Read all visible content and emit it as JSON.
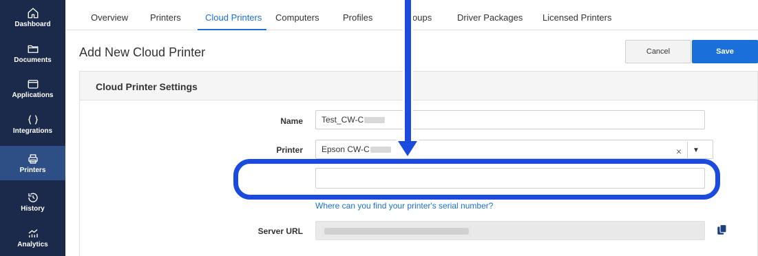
{
  "sidebar": {
    "items": [
      {
        "label": "Dashboard",
        "icon": "home-icon"
      },
      {
        "label": "Documents",
        "icon": "folder-icon"
      },
      {
        "label": "Applications",
        "icon": "window-icon"
      },
      {
        "label": "Integrations",
        "icon": "braces-icon"
      },
      {
        "label": "Printers",
        "icon": "printer-icon",
        "active": true
      },
      {
        "label": "History",
        "icon": "history-icon"
      },
      {
        "label": "Analytics",
        "icon": "analytics-icon"
      }
    ]
  },
  "tabs": [
    "Overview",
    "Printers",
    "Cloud Printers",
    "Computers",
    "Profiles",
    "Groups",
    "Driver Packages",
    "Licensed Printers"
  ],
  "tabs_visible": [
    "Overview",
    "Printers",
    "Cloud Printers",
    "Computers",
    "Profiles",
    "oups",
    "Driver Packages",
    "Licensed Printers"
  ],
  "active_tab": "Cloud Printers",
  "page": {
    "title": "Add New Cloud Printer",
    "cancel_label": "Cancel",
    "save_label": "Save"
  },
  "panel": {
    "title": "Cloud Printer Settings",
    "name_label": "Name",
    "name_value": "Test_CW-C",
    "printer_label": "Printer",
    "printer_value": "Epson CW-C",
    "clear_glyph": "×",
    "dropdown_glyph": "▼",
    "help_link": "Where can you find your printer's serial number?",
    "server_url_label": "Server URL"
  },
  "colors": {
    "sidebar_bg": "#1b2a4a",
    "sidebar_active": "#2d4f86",
    "accent": "#1a6fd8",
    "annotation": "#1a4bdc"
  }
}
